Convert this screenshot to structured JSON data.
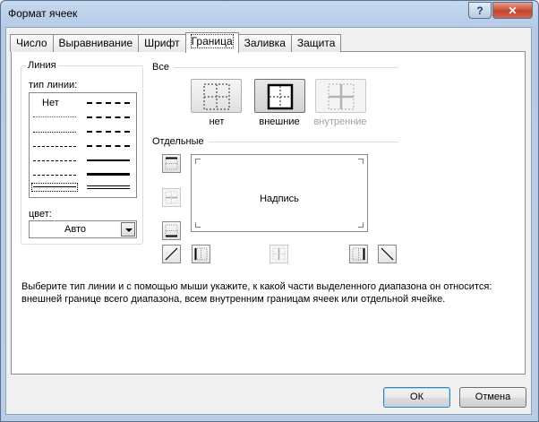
{
  "window": {
    "title": "Формат ячеек",
    "help_label": "?",
    "close_label": "✕"
  },
  "tabs": [
    {
      "label": "Число"
    },
    {
      "label": "Выравнивание"
    },
    {
      "label": "Шрифт"
    },
    {
      "label": "Граница",
      "active": true
    },
    {
      "label": "Заливка"
    },
    {
      "label": "Защита"
    }
  ],
  "line_group": {
    "title": "Линия",
    "type_label": "тип линии:",
    "none_option": "Нет",
    "color_label": "цвет:",
    "color_value": "Авто"
  },
  "presets": {
    "title": "Все",
    "items": [
      {
        "label": "нет",
        "icon": "border-none-icon"
      },
      {
        "label": "внешние",
        "icon": "border-outline-icon",
        "selected": true
      },
      {
        "label": "внутренние",
        "icon": "border-inside-icon",
        "disabled": true
      }
    ]
  },
  "border": {
    "title": "Отдельные",
    "preview_text": "Надпись",
    "buttons": [
      {
        "name": "border-top-icon"
      },
      {
        "name": "border-inner-horizontal-icon",
        "disabled": true
      },
      {
        "name": "border-bottom-icon"
      },
      {
        "name": "border-diagonal-up-icon"
      },
      {
        "name": "border-left-icon"
      },
      {
        "name": "border-inner-vertical-icon",
        "disabled": true
      },
      {
        "name": "border-right-icon"
      },
      {
        "name": "border-diagonal-down-icon"
      }
    ]
  },
  "description": "Выберите тип линии и с помощью мыши укажите, к какой части выделенного диапазона он относится: внешней границе всего диапазона, всем внутренним границам ячеек или отдельной ячейке.",
  "footer": {
    "ok_label": "ОК",
    "cancel_label": "Отмена"
  }
}
